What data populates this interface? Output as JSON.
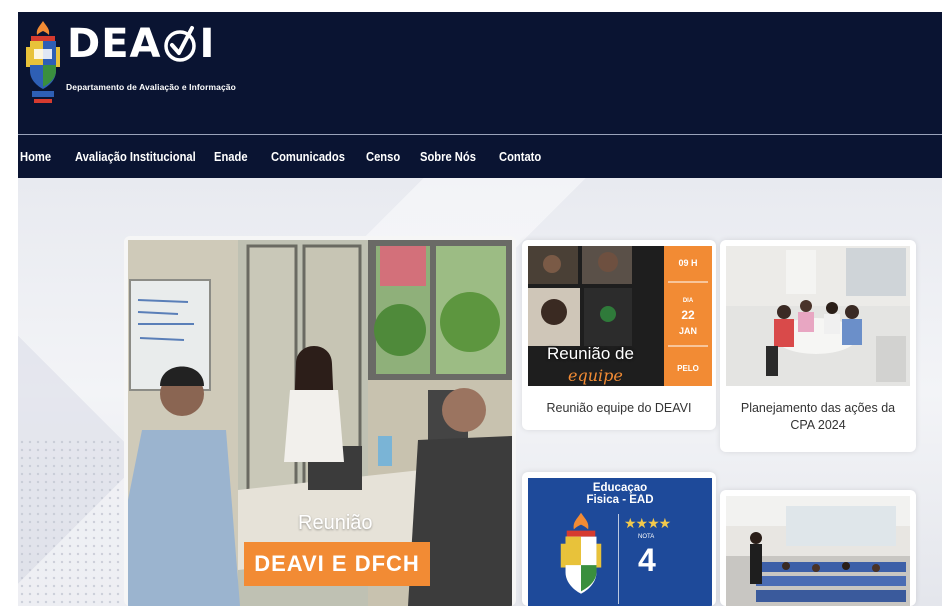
{
  "header": {
    "logo_main": "DEA",
    "logo_end": "I",
    "logo_subtitle": "Departamento de Avaliação e Informação"
  },
  "nav": {
    "items": [
      {
        "label": "Home"
      },
      {
        "label": "Avaliação Institucional"
      },
      {
        "label": "Enade"
      },
      {
        "label": "Comunicados"
      },
      {
        "label": "Censo"
      },
      {
        "label": "Sobre Nós"
      },
      {
        "label": "Contato"
      }
    ]
  },
  "hero": {
    "caption": "Reunião",
    "banner": "DEAVI E DFCH"
  },
  "cards": [
    {
      "title": "Reunião equipe do DEAVI",
      "thumb_line1": "Reunião de",
      "thumb_line2": "equipe",
      "side_top": "09 H",
      "side_day_label": "DIA",
      "side_day": "22",
      "side_month": "JAN",
      "side_bottom": "PELO"
    },
    {
      "title": "Planejamento das ações da CPA 2024"
    },
    {
      "thumb_title_line1": "Educaçao",
      "thumb_title_line2": "Fisica - EAD",
      "stars": "★★★★",
      "nota_label": "NOTA",
      "nota_value": "4"
    },
    {}
  ],
  "colors": {
    "navy": "#0a1432",
    "orange": "#f28b34",
    "blue_card": "#1e4a9a"
  }
}
